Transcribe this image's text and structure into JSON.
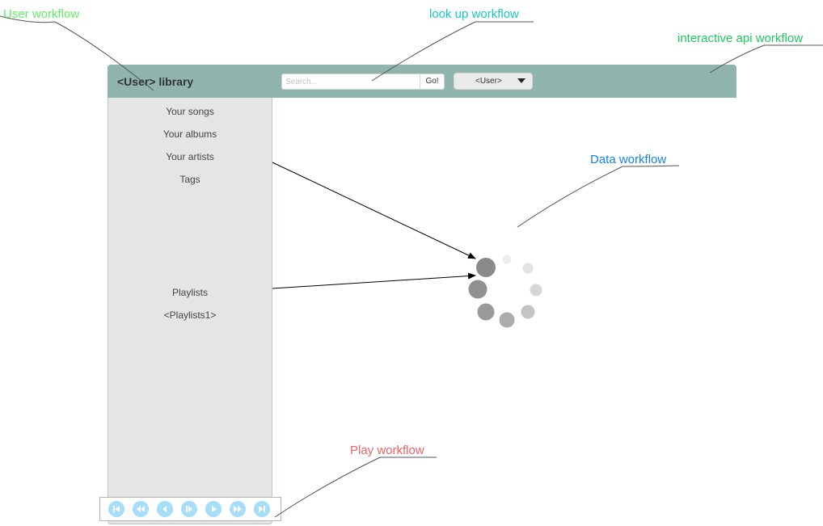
{
  "annotations": {
    "user_workflow": "User workflow",
    "lookup_workflow": "look up workflow",
    "interactive_api_workflow": "interactive api workflow",
    "data_workflow": "Data workflow",
    "play_workflow": "Play workflow"
  },
  "header": {
    "library_title": "<User> library",
    "search_placeholder": "Search...",
    "go_label": "Go!",
    "user_select_value": "<User>"
  },
  "sidebar": {
    "items": [
      "Your songs",
      "Your albums",
      "Your artists",
      "Tags"
    ],
    "playlists_heading": "Playlists",
    "playlist_items": [
      "<Playlists1>"
    ]
  },
  "player": {
    "buttons": [
      "skip-to-start-icon",
      "rewind-icon",
      "previous-icon",
      "pause-icon",
      "play-icon",
      "fast-forward-icon",
      "skip-to-end-icon"
    ]
  },
  "colors": {
    "topbar": "#8fb5ad",
    "sidebar": "#e5e5e5",
    "player_button": "#a6ddf9",
    "user_workflow": "#62f062",
    "lookup_workflow": "#19c7c7",
    "interactive_api_workflow": "#1ec961",
    "data_workflow": "#1583e0",
    "play_workflow": "#f06262"
  }
}
